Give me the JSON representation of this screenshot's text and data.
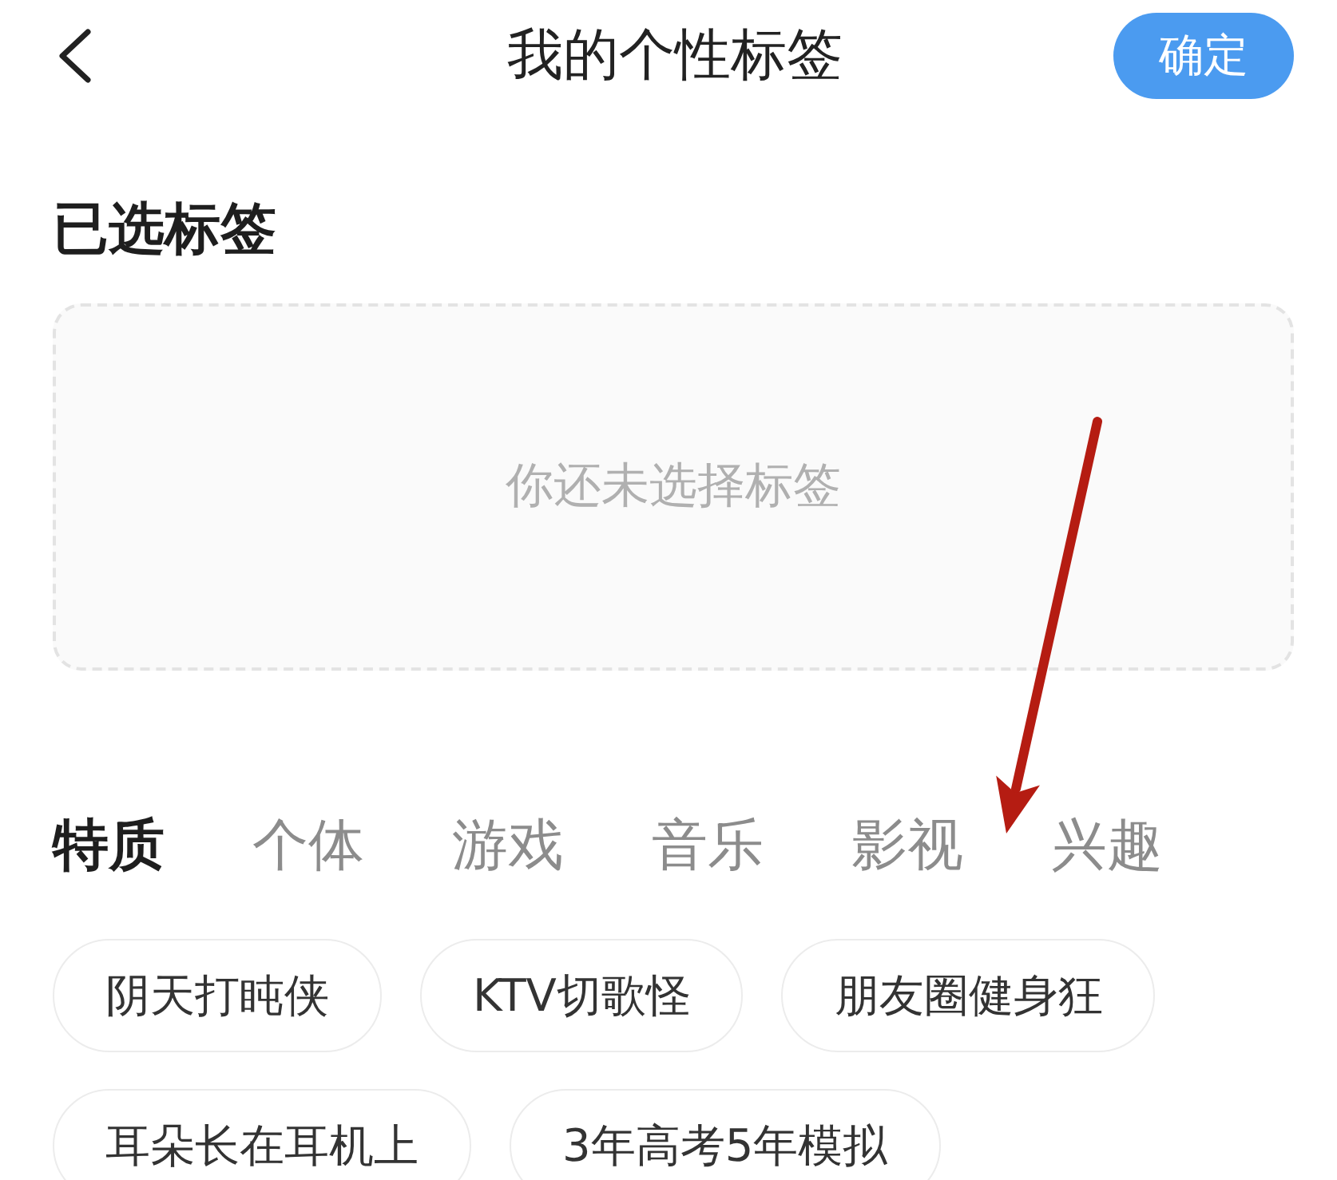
{
  "header": {
    "title": "我的个性标签",
    "confirm_button": "确定"
  },
  "selected_section": {
    "title": "已选标签",
    "empty_text": "你还未选择标签"
  },
  "tabs": [
    {
      "label": "特质",
      "selected": true
    },
    {
      "label": "个体",
      "selected": false
    },
    {
      "label": "游戏",
      "selected": false
    },
    {
      "label": "音乐",
      "selected": false
    },
    {
      "label": "影视",
      "selected": false
    },
    {
      "label": "兴趣",
      "selected": false
    }
  ],
  "tags": [
    "阴天打盹侠",
    "KTV切歌怪",
    "朋友圈健身狂",
    "耳朵长在耳机上",
    "3年高考5年模拟"
  ]
}
